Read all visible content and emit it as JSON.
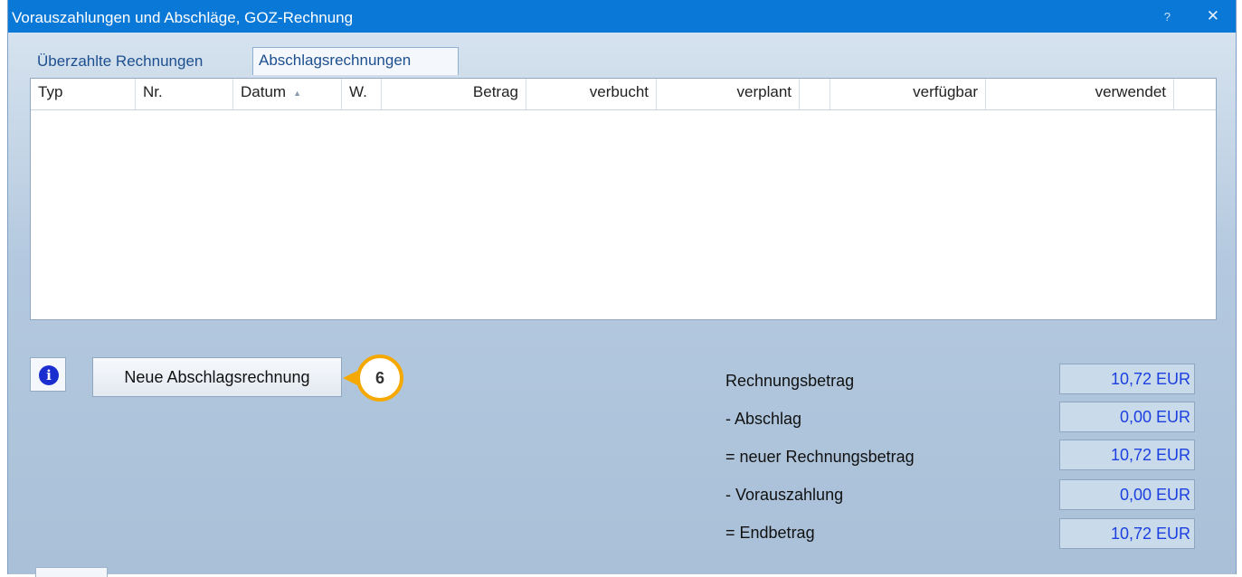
{
  "window": {
    "title": "Vorauszahlungen und Abschläge, GOZ-Rechnung",
    "help_label": "?",
    "close_label": "✕"
  },
  "tabs": [
    {
      "label": "Überzahlte Rechnungen"
    },
    {
      "label": "Abschlagsrechnungen"
    }
  ],
  "table": {
    "columns": [
      "Typ",
      "Nr.",
      "Datum",
      "W.",
      "Betrag",
      "verbucht",
      "verplant",
      "",
      "verfügbar",
      "verwendet"
    ],
    "sort_indicator": "▲",
    "rows": []
  },
  "buttons": {
    "info_icon": "i",
    "new_invoice_label": "Neue Abschlagsrechnung"
  },
  "callout": {
    "number": "6",
    "color": "#f5a800"
  },
  "summary": [
    {
      "label": "Rechnungsbetrag",
      "value": "10,72 EUR"
    },
    {
      "label": "- Abschlag",
      "value": "0,00 EUR"
    },
    {
      "label": "= neuer Rechnungsbetrag",
      "value": "10,72 EUR"
    },
    {
      "label": "- Vorauszahlung",
      "value": "0,00 EUR"
    },
    {
      "label": "= Endbetrag",
      "value": "10,72 EUR"
    }
  ],
  "colors": {
    "titlebar": "#0a78d7",
    "value_text": "#1b3fe0"
  }
}
